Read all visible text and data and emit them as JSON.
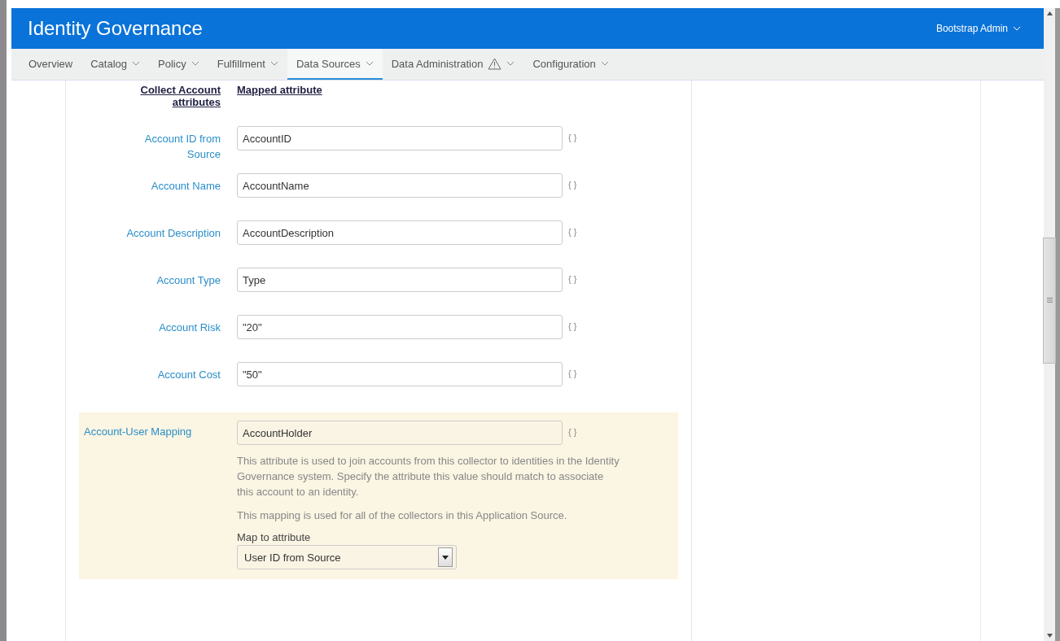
{
  "header": {
    "title": "Identity Governance",
    "user_menu": "Bootstrap Admin"
  },
  "nav": [
    {
      "label": "Overview",
      "dropdown": false,
      "warning": false,
      "selected": false
    },
    {
      "label": "Catalog",
      "dropdown": true,
      "warning": false,
      "selected": false
    },
    {
      "label": "Policy",
      "dropdown": true,
      "warning": false,
      "selected": false
    },
    {
      "label": "Fulfillment",
      "dropdown": true,
      "warning": false,
      "selected": false
    },
    {
      "label": "Data Sources",
      "dropdown": true,
      "warning": false,
      "selected": true
    },
    {
      "label": "Data Administration",
      "dropdown": true,
      "warning": true,
      "selected": false
    },
    {
      "label": "Configuration",
      "dropdown": true,
      "warning": false,
      "selected": false
    }
  ],
  "columns": [
    "Collect Account attributes",
    "Mapped attribute"
  ],
  "rows": [
    {
      "label": "Account ID from Source",
      "value": "AccountID",
      "hint": "{ }"
    },
    {
      "label": "Account Name",
      "value": "AccountName",
      "hint": "{ }"
    },
    {
      "label": "Account Description",
      "value": "AccountDescription",
      "hint": "{ }"
    },
    {
      "label": "Account Type",
      "value": "Type",
      "hint": "{ }"
    },
    {
      "label": "Account Risk",
      "value": "\"20\"",
      "hint": "{ }"
    },
    {
      "label": "Account Cost",
      "value": "\"50\"",
      "hint": "{ }"
    }
  ],
  "mapping": {
    "label": "Account-User Mapping",
    "value": "AccountHolder",
    "hint": "{ }",
    "help": [
      "This attribute is used to join accounts from this collector to identities in the Identity Governance system. Specify the attribute this value should match to associate this account to an identity.",
      "This mapping is used for all of the collectors in this Application Source."
    ],
    "select_label": "Map to attribute",
    "select_value": "User ID from Source"
  }
}
